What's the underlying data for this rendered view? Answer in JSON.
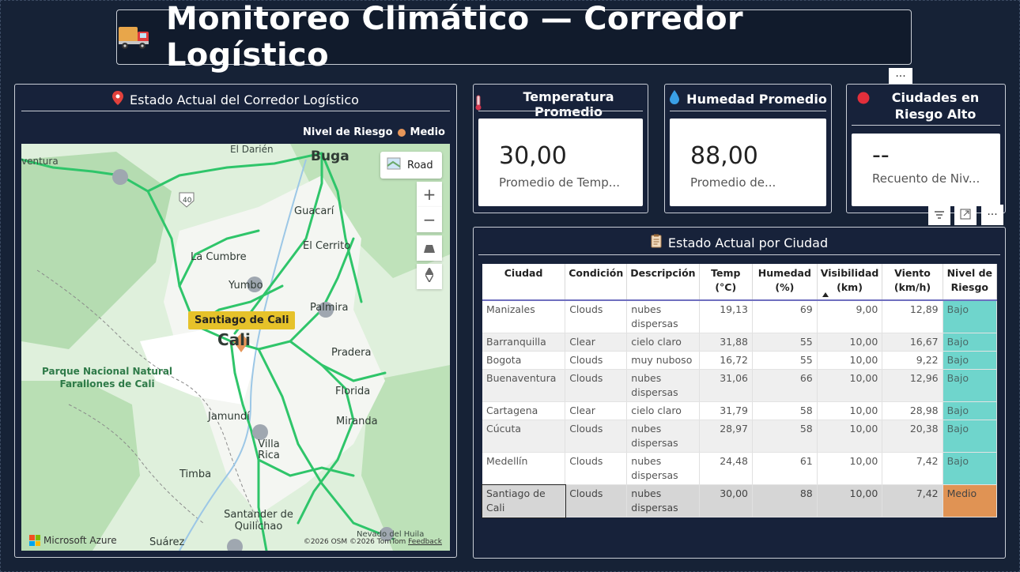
{
  "header": {
    "title": "Monitoreo Climático — Corredor Logístico"
  },
  "map": {
    "title": "Estado Actual del Corredor Logístico",
    "legend_label": "Nivel de Riesgo",
    "legend_value": "Medio",
    "legend_color": "#e7965a",
    "style_button": "Road",
    "tooltip": "Santiago de Cali",
    "attribution": "Microsoft Azure",
    "copyright": "©2026 OSM  ©2026 TomTom",
    "feedback": "Feedback",
    "labels": {
      "ventura": "ventura",
      "el_darien": "El Darién",
      "buga": "Buga",
      "road40": "40",
      "guacari": "Guacarí",
      "la_cumbre": "La Cumbre",
      "el_cerrito": "El Cerrito",
      "yumbo": "Yumbo",
      "palmira": "Palmira",
      "cali": "Cali",
      "pradera": "Pradera",
      "park_line1": "Parque Nacional Natural",
      "park_line2": "Farallones de Cali",
      "florida": "Florida",
      "jamundi": "Jamundí",
      "miranda": "Miranda",
      "villa_rica": "Villa Rica",
      "timba": "Timba",
      "santander": "Santander de Quilichao",
      "nevado": "Nevado del Huila",
      "suarez": "Suárez"
    }
  },
  "cards": [
    {
      "title": "Temperatura Promedio",
      "icon": "thermometer-icon",
      "value": "30,00",
      "subtitle": "Promedio de Temp..."
    },
    {
      "title": "Humedad Promedio",
      "icon": "droplet-icon",
      "value": "88,00",
      "subtitle": "Promedio de..."
    },
    {
      "title": "Ciudades en Riesgo Alto",
      "icon": "red-circle-icon",
      "value": "--",
      "subtitle": "Recuento de Niv..."
    }
  ],
  "more_options": "···",
  "table": {
    "title": "Estado Actual por Ciudad",
    "columns": [
      "Ciudad",
      "Condición",
      "Descripción",
      "Temp (°C)",
      "Humedad (%)",
      "Visibilidad (km)",
      "Viento (km/h)",
      "Nivel de Riesgo"
    ],
    "rows": [
      [
        "Manizales",
        "Clouds",
        "nubes dispersas",
        "19,13",
        "69",
        "9,00",
        "12,89",
        "Bajo"
      ],
      [
        "Barranquilla",
        "Clear",
        "cielo claro",
        "31,88",
        "55",
        "10,00",
        "16,67",
        "Bajo"
      ],
      [
        "Bogota",
        "Clouds",
        "muy nuboso",
        "16,72",
        "55",
        "10,00",
        "9,22",
        "Bajo"
      ],
      [
        "Buenaventura",
        "Clouds",
        "nubes dispersas",
        "31,06",
        "66",
        "10,00",
        "12,96",
        "Bajo"
      ],
      [
        "Cartagena",
        "Clear",
        "cielo claro",
        "31,79",
        "58",
        "10,00",
        "28,98",
        "Bajo"
      ],
      [
        "Cúcuta",
        "Clouds",
        "nubes dispersas",
        "28,97",
        "58",
        "10,00",
        "20,38",
        "Bajo"
      ],
      [
        "Medellín",
        "Clouds",
        "nubes dispersas",
        "24,48",
        "61",
        "10,00",
        "7,42",
        "Bajo"
      ],
      [
        "Santiago de Cali",
        "Clouds",
        "nubes dispersas",
        "30,00",
        "88",
        "10,00",
        "7,42",
        "Medio"
      ]
    ],
    "risk_colors": {
      "Bajo": "#6fd5cc",
      "Medio": "#e09354"
    }
  }
}
